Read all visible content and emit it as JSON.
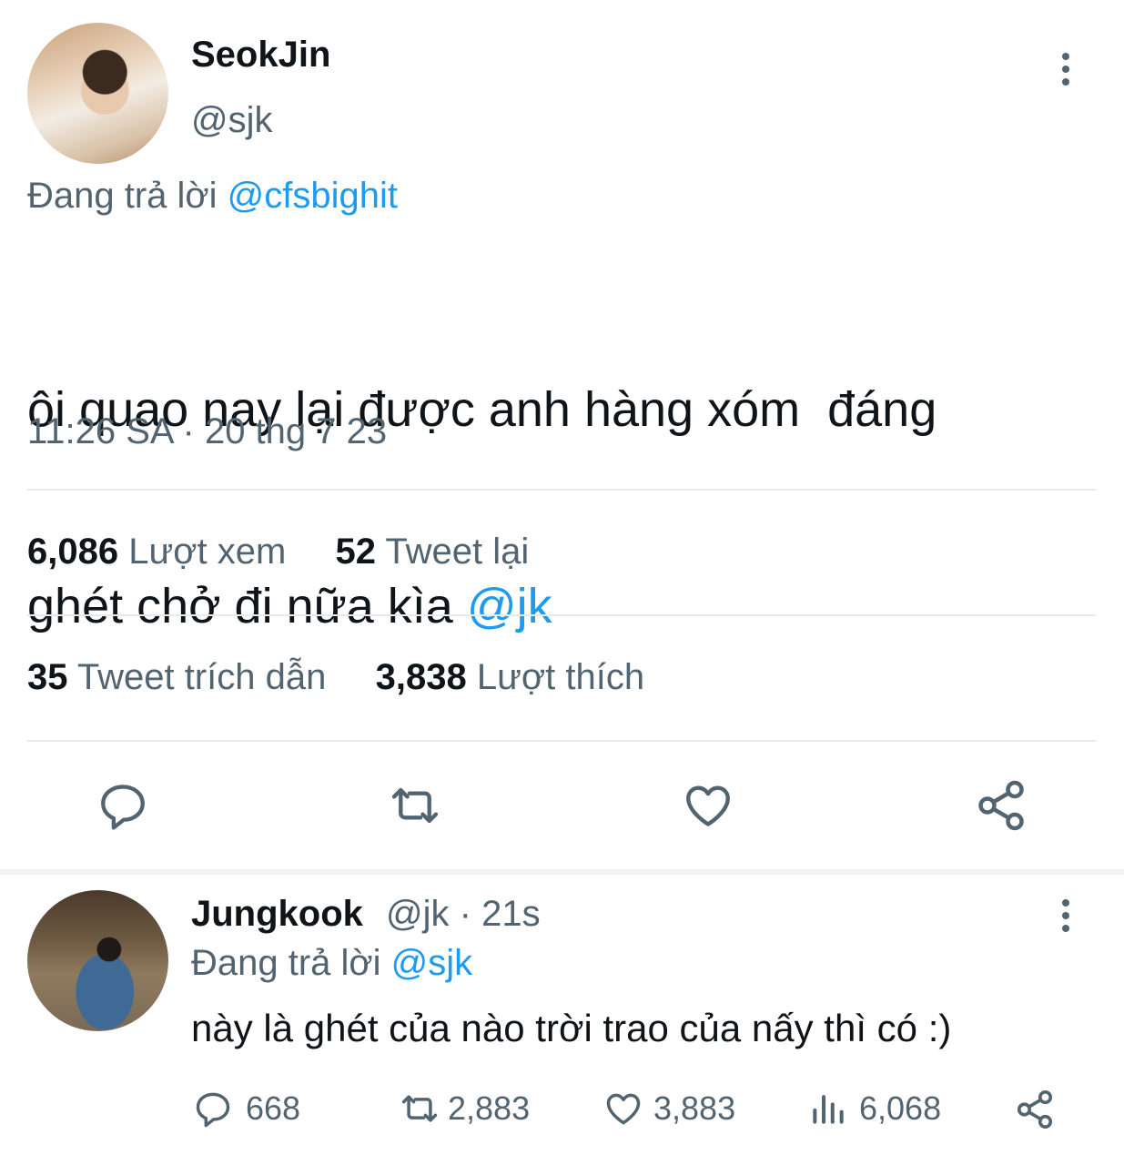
{
  "main_tweet": {
    "display_name": "SeokJin",
    "handle": "@sjk",
    "replying_prefix": "Đang trả lời",
    "replying_to": "@cfsbighit",
    "text_line1": "ôi quao nay lại được anh hàng xóm  đáng",
    "text_line2_prefix": "ghét chở đi nữa kìa",
    "mention": "@jk",
    "timestamp": "11:26 SA · 20 thg 7 23",
    "stats": {
      "views_count": "6,086",
      "views_label": "Lượt xem",
      "retweets_count": "52",
      "retweets_label": "Tweet lại",
      "quotes_count": "35",
      "quotes_label": "Tweet trích dẫn",
      "likes_count": "3,838",
      "likes_label": "Lượt thích"
    },
    "actions": [
      "reply-icon",
      "retweet-icon",
      "like-icon",
      "share-icon"
    ]
  },
  "reply_tweet": {
    "display_name": "Jungkook",
    "handle_time": "@jk · 21s",
    "replying_prefix": "Đang trả lời",
    "replying_to": "@sjk",
    "text": "này là ghét của nào trời trao của nấy thì có :)",
    "counts": {
      "replies": "668",
      "retweets": "2,883",
      "likes": "3,883",
      "views": "6,068"
    }
  },
  "colors": {
    "link": "#1d9bf0",
    "muted": "#536471",
    "text": "#0f1419",
    "divider": "#e7e9ea"
  }
}
